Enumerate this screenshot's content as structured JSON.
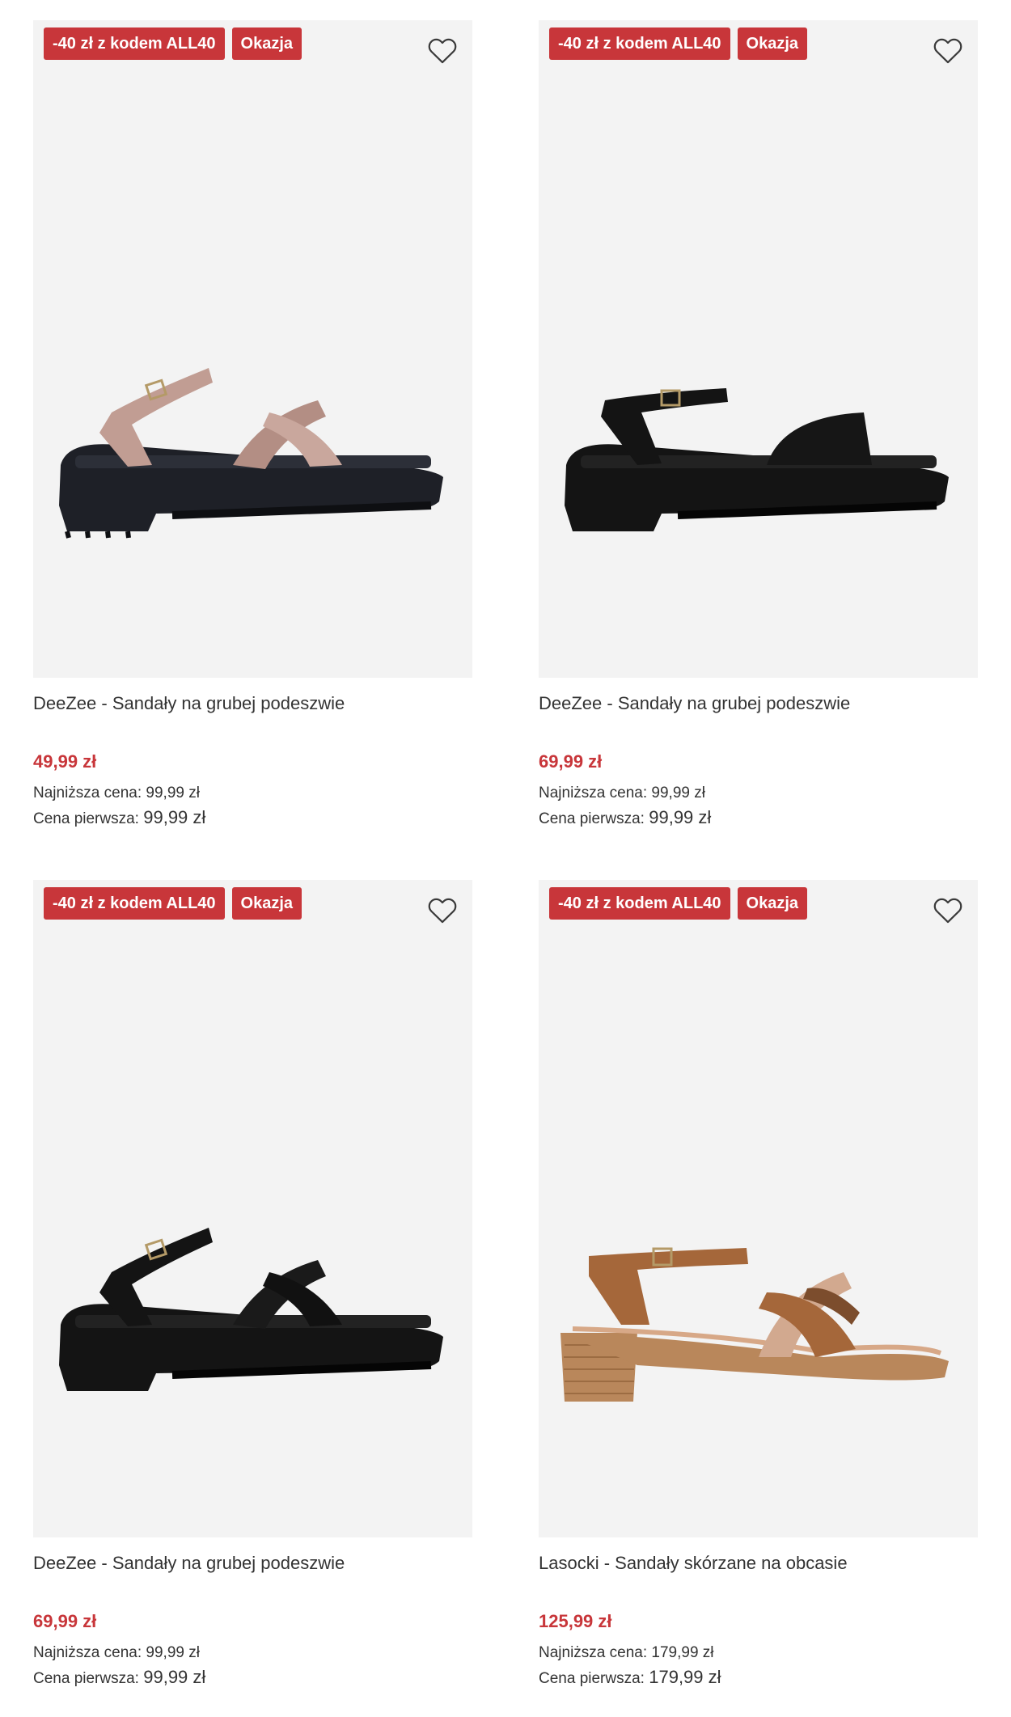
{
  "products": [
    {
      "badges": [
        "-40 zł z kodem ALL40",
        "Okazja"
      ],
      "title": "DeeZee - Sandały na grubej podeszwie",
      "price": "49,99 zł",
      "lowest_price_label": "Najniższa cena:",
      "lowest_price": "99,99 zł",
      "first_price_label": "Cena pierwsza:",
      "first_price": "99,99 zł",
      "colors": {
        "strap": "#c19d93",
        "sole": "#1e2027"
      }
    },
    {
      "badges": [
        "-40 zł z kodem ALL40",
        "Okazja"
      ],
      "title": "DeeZee - Sandały na grubej podeszwie",
      "price": "69,99 zł",
      "lowest_price_label": "Najniższa cena:",
      "lowest_price": "99,99 zł",
      "first_price_label": "Cena pierwsza:",
      "first_price": "99,99 zł",
      "colors": {
        "strap": "#141414",
        "sole": "#141414"
      }
    },
    {
      "badges": [
        "-40 zł z kodem ALL40",
        "Okazja"
      ],
      "title": "DeeZee - Sandały na grubej podeszwie",
      "price": "69,99 zł",
      "lowest_price_label": "Najniższa cena:",
      "lowest_price": "99,99 zł",
      "first_price_label": "Cena pierwsza:",
      "first_price": "99,99 zł",
      "colors": {
        "strap": "#141414",
        "sole": "#141414"
      }
    },
    {
      "badges": [
        "-40 zł z kodem ALL40",
        "Okazja"
      ],
      "title": "Lasocki - Sandały skórzane na obcasie",
      "price": "125,99 zł",
      "lowest_price_label": "Najniższa cena:",
      "lowest_price": "179,99 zł",
      "first_price_label": "Cena pierwsza:",
      "first_price": "179,99 zł",
      "colors": {
        "strap": "#a5673a",
        "sole": "#b9875b"
      }
    }
  ],
  "theme": {
    "accent": "#c8363a",
    "image_background": "#f3f3f3"
  },
  "icons": {
    "wishlist": "heart-outline-icon"
  }
}
